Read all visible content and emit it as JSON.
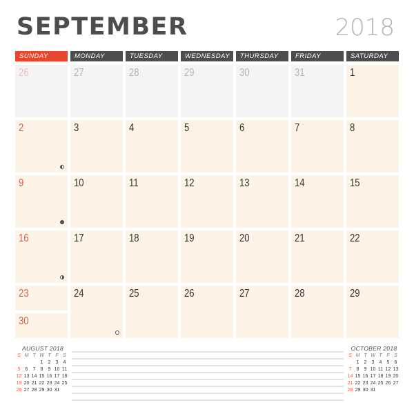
{
  "header": {
    "month": "SEPTEMBER",
    "year": "2018"
  },
  "weekdays": [
    "SUNDAY",
    "MONDAY",
    "TUESDAY",
    "WEDNESDAY",
    "THURSDAY",
    "FRIDAY",
    "SATURDAY"
  ],
  "weeks": [
    [
      {
        "d": "26",
        "prev": true
      },
      {
        "d": "27",
        "prev": true
      },
      {
        "d": "28",
        "prev": true
      },
      {
        "d": "29",
        "prev": true
      },
      {
        "d": "30",
        "prev": true
      },
      {
        "d": "31",
        "prev": true
      },
      {
        "d": "1"
      }
    ],
    [
      {
        "d": "2",
        "moon": "last"
      },
      {
        "d": "3"
      },
      {
        "d": "4"
      },
      {
        "d": "5"
      },
      {
        "d": "6"
      },
      {
        "d": "7"
      },
      {
        "d": "8"
      }
    ],
    [
      {
        "d": "9",
        "moon": "new"
      },
      {
        "d": "10"
      },
      {
        "d": "11"
      },
      {
        "d": "12"
      },
      {
        "d": "13"
      },
      {
        "d": "14"
      },
      {
        "d": "15"
      }
    ],
    [
      {
        "d": "16",
        "moon": "first"
      },
      {
        "d": "17"
      },
      {
        "d": "18"
      },
      {
        "d": "19"
      },
      {
        "d": "20"
      },
      {
        "d": "21"
      },
      {
        "d": "22"
      }
    ],
    [
      {
        "d": "23",
        "split": "30"
      },
      {
        "d": "24",
        "moon": "full"
      },
      {
        "d": "25"
      },
      {
        "d": "26"
      },
      {
        "d": "27"
      },
      {
        "d": "28"
      },
      {
        "d": "29"
      }
    ]
  ],
  "mini_calendars": [
    {
      "title": "AUGUST 2018",
      "dow": [
        "S",
        "M",
        "T",
        "W",
        "T",
        "F",
        "S"
      ],
      "days": [
        "",
        "",
        "",
        "1",
        "2",
        "3",
        "4",
        "5",
        "6",
        "7",
        "8",
        "9",
        "10",
        "11",
        "12",
        "13",
        "14",
        "15",
        "16",
        "17",
        "18",
        "19",
        "20",
        "21",
        "22",
        "23",
        "24",
        "25",
        "26",
        "27",
        "28",
        "29",
        "30",
        "31"
      ]
    },
    {
      "title": "OCTOBER 2018",
      "dow": [
        "S",
        "M",
        "T",
        "W",
        "T",
        "F",
        "S"
      ],
      "days": [
        "",
        "1",
        "2",
        "3",
        "4",
        "5",
        "6",
        "7",
        "8",
        "9",
        "10",
        "11",
        "12",
        "13",
        "14",
        "15",
        "16",
        "17",
        "18",
        "19",
        "20",
        "21",
        "22",
        "23",
        "24",
        "25",
        "26",
        "27",
        "28",
        "29",
        "30",
        "31"
      ]
    }
  ],
  "notes": {
    "line_count": 8
  },
  "colors": {
    "accent": "#e8452f",
    "header_bg": "#4d4d4d",
    "cell_bg": "#fdf3e6",
    "prev_cell_bg": "#f4f4f4",
    "sunday_text": "#d9614a"
  }
}
